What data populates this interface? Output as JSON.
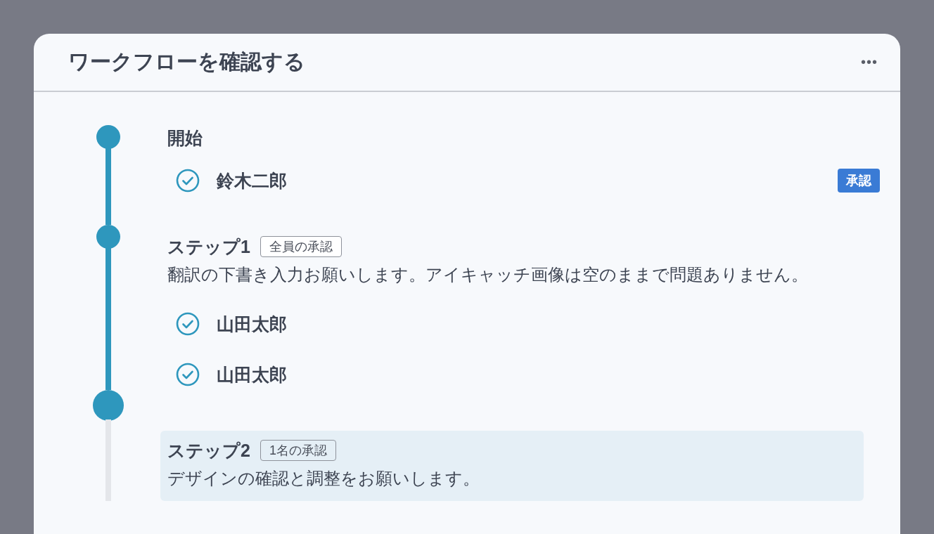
{
  "card": {
    "title": "ワークフローを確認する",
    "menu_label": "•••"
  },
  "steps": [
    {
      "completed": true,
      "current": false,
      "title": "開始",
      "approvers": [
        {
          "name": "鈴木二郎",
          "checked": true,
          "status": "承認"
        }
      ]
    },
    {
      "completed": true,
      "current": false,
      "title": "ステップ1",
      "rule": "全員の承認",
      "description": "翻訳の下書き入力お願いします。アイキャッチ画像は空のままで問題ありません。",
      "approvers": [
        {
          "name": "山田太郎",
          "checked": true
        },
        {
          "name": "山田太郎",
          "checked": true
        }
      ]
    },
    {
      "completed": false,
      "current": true,
      "title": "ステップ2",
      "rule": "1名の承認",
      "description": "デザインの確認と調整をお願いします。"
    }
  ]
}
